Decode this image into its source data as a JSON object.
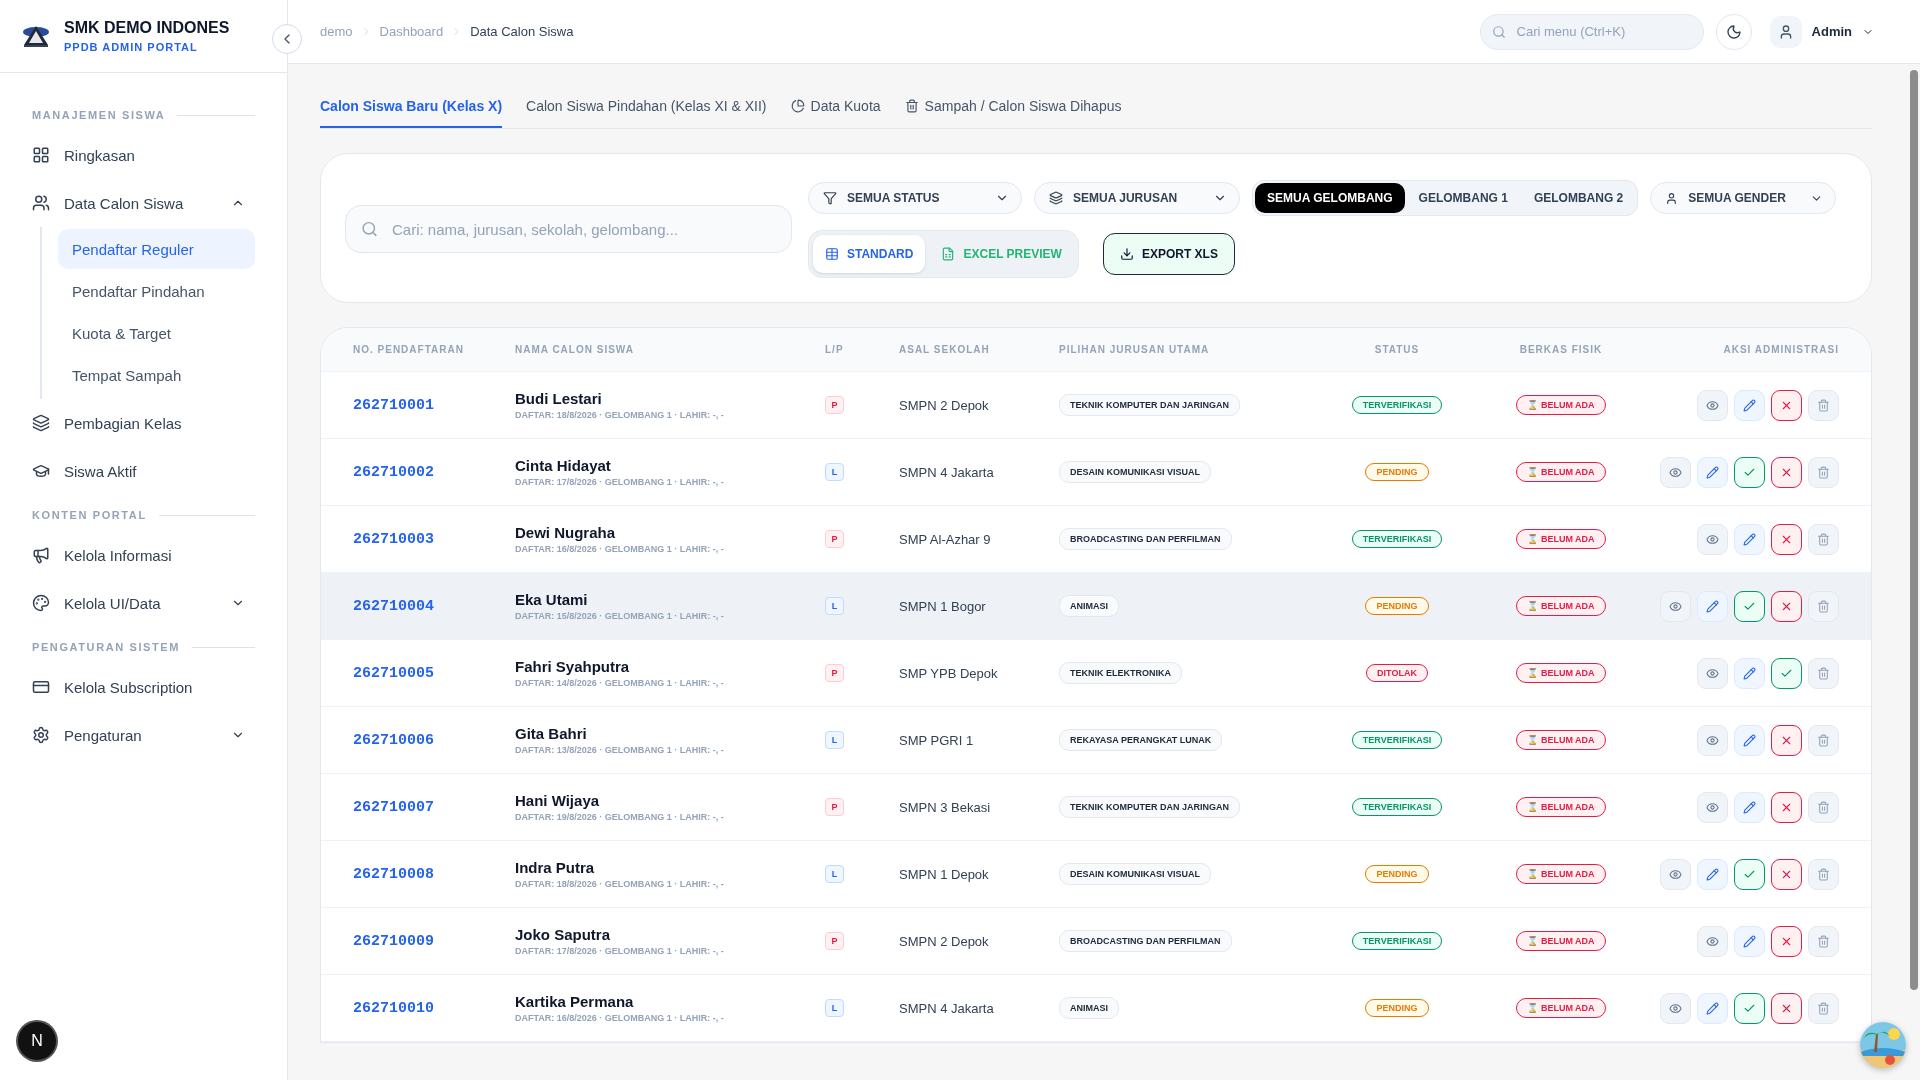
{
  "brand": {
    "name": "SMK DEMO INDONES",
    "subtitle": "PPDB ADMIN PORTAL"
  },
  "breadcrumb": [
    "demo",
    "Dashboard",
    "Data Calon Siswa"
  ],
  "header": {
    "search_placeholder": "Cari menu (Ctrl+K)",
    "user": "Admin"
  },
  "sidebar": {
    "sections": [
      {
        "title": "MANAJEMEN SISWA",
        "items": [
          {
            "label": "Ringkasan",
            "selected": false
          },
          {
            "label": "Data Calon Siswa",
            "selected": false,
            "expanded": true,
            "children": [
              {
                "label": "Pendaftar Reguler",
                "selected": true
              },
              {
                "label": "Pendaftar Pindahan",
                "selected": false
              },
              {
                "label": "Kuota & Target",
                "selected": false
              },
              {
                "label": "Tempat Sampah",
                "selected": false
              }
            ]
          },
          {
            "label": "Pembagian Kelas",
            "selected": false
          },
          {
            "label": "Siswa Aktif",
            "selected": false
          }
        ]
      },
      {
        "title": "KONTEN PORTAL",
        "items": [
          {
            "label": "Kelola Informasi",
            "selected": false
          },
          {
            "label": "Kelola UI/Data",
            "selected": false,
            "expanded": false
          }
        ]
      },
      {
        "title": "PENGATURAN SISTEM",
        "items": [
          {
            "label": "Kelola Subscription",
            "selected": false
          },
          {
            "label": "Pengaturan",
            "selected": false,
            "expanded": false
          }
        ]
      }
    ]
  },
  "tabs": [
    {
      "label": "Calon Siswa Baru (Kelas X)",
      "selected": true
    },
    {
      "label": "Calon Siswa Pindahan (Kelas XI & XII)",
      "selected": false
    },
    {
      "label": "Data Kuota",
      "selected": false
    },
    {
      "label": "Sampah / Calon Siswa Dihapus",
      "selected": false
    }
  ],
  "filters": {
    "search_placeholder": "Cari: nama, jurusan, sekolah, gelombang...",
    "status": "SEMUA STATUS",
    "jurusan": "SEMUA JURUSAN",
    "gelombang": [
      {
        "label": "SEMUA GELOMBANG",
        "selected": true
      },
      {
        "label": "GELOMBANG 1",
        "selected": false
      },
      {
        "label": "GELOMBANG 2",
        "selected": false
      }
    ],
    "gender": "SEMUA GENDER",
    "views": [
      {
        "label": "STANDARD",
        "kind": "table",
        "selected": true
      },
      {
        "label": "EXCEL PREVIEW",
        "kind": "sheet",
        "selected": false
      }
    ],
    "export": "EXPORT XLS"
  },
  "table": {
    "columns": [
      "NO. PENDAFTARAN",
      "NAMA CALON SISWA",
      "L/P",
      "ASAL SEKOLAH",
      "PILIHAN JURUSAN UTAMA",
      "STATUS",
      "BERKAS FISIK",
      "AKSI ADMINISTRASI"
    ],
    "rows": [
      {
        "no": "262710001",
        "name": "Budi Lestari",
        "meta": "DAFTAR: 18/8/2026 · GELOMBANG 1 · LAHIR: -, -",
        "gender": "P",
        "school": "SMPN 2 Depok",
        "major": "TEKNIK KOMPUTER DAN JARINGAN",
        "status": "TERVERIFIKASI",
        "kind": "verified",
        "berkas": "⌛ BELUM ADA",
        "highlighted": false
      },
      {
        "no": "262710002",
        "name": "Cinta Hidayat",
        "meta": "DAFTAR: 17/8/2026 · GELOMBANG 1 · LAHIR: -, -",
        "gender": "L",
        "school": "SMPN 4 Jakarta",
        "major": "DESAIN KOMUNIKASI VISUAL",
        "status": "PENDING",
        "kind": "pending",
        "berkas": "⌛ BELUM ADA",
        "highlighted": false
      },
      {
        "no": "262710003",
        "name": "Dewi Nugraha",
        "meta": "DAFTAR: 16/8/2026 · GELOMBANG 1 · LAHIR: -, -",
        "gender": "P",
        "school": "SMP Al-Azhar 9",
        "major": "BROADCASTING DAN PERFILMAN",
        "status": "TERVERIFIKASI",
        "kind": "verified",
        "berkas": "⌛ BELUM ADA",
        "highlighted": false
      },
      {
        "no": "262710004",
        "name": "Eka Utami",
        "meta": "DAFTAR: 15/8/2026 · GELOMBANG 1 · LAHIR: -, -",
        "gender": "L",
        "school": "SMPN 1 Bogor",
        "major": "ANIMASI",
        "status": "PENDING",
        "kind": "pending",
        "berkas": "⌛ BELUM ADA",
        "highlighted": true
      },
      {
        "no": "262710005",
        "name": "Fahri Syahputra",
        "meta": "DAFTAR: 14/8/2026 · GELOMBANG 1 · LAHIR: -, -",
        "gender": "P",
        "school": "SMP YPB Depok",
        "major": "TEKNIK ELEKTRONIKA",
        "status": "DITOLAK",
        "kind": "rejected",
        "berkas": "⌛ BELUM ADA",
        "highlighted": false
      },
      {
        "no": "262710006",
        "name": "Gita Bahri",
        "meta": "DAFTAR: 13/8/2026 · GELOMBANG 1 · LAHIR: -, -",
        "gender": "L",
        "school": "SMP PGRI 1",
        "major": "REKAYASA PERANGKAT LUNAK",
        "status": "TERVERIFIKASI",
        "kind": "verified",
        "berkas": "⌛ BELUM ADA",
        "highlighted": false
      },
      {
        "no": "262710007",
        "name": "Hani Wijaya",
        "meta": "DAFTAR: 19/8/2026 · GELOMBANG 1 · LAHIR: -, -",
        "gender": "P",
        "school": "SMPN 3 Bekasi",
        "major": "TEKNIK KOMPUTER DAN JARINGAN",
        "status": "TERVERIFIKASI",
        "kind": "verified",
        "berkas": "⌛ BELUM ADA",
        "highlighted": false
      },
      {
        "no": "262710008",
        "name": "Indra Putra",
        "meta": "DAFTAR: 18/8/2026 · GELOMBANG 1 · LAHIR: -, -",
        "gender": "L",
        "school": "SMPN 1 Depok",
        "major": "DESAIN KOMUNIKASI VISUAL",
        "status": "PENDING",
        "kind": "pending",
        "berkas": "⌛ BELUM ADA",
        "highlighted": false
      },
      {
        "no": "262710009",
        "name": "Joko Saputra",
        "meta": "DAFTAR: 17/8/2026 · GELOMBANG 1 · LAHIR: -, -",
        "gender": "P",
        "school": "SMPN 2 Depok",
        "major": "BROADCASTING DAN PERFILMAN",
        "status": "TERVERIFIKASI",
        "kind": "verified",
        "berkas": "⌛ BELUM ADA",
        "highlighted": false
      },
      {
        "no": "262710010",
        "name": "Kartika Permana",
        "meta": "DAFTAR: 16/8/2026 · GELOMBANG 1 · LAHIR: -, -",
        "gender": "L",
        "school": "SMPN 4 Jakarta",
        "major": "ANIMASI",
        "status": "PENDING",
        "kind": "pending",
        "berkas": "⌛ BELUM ADA",
        "highlighted": false
      }
    ]
  },
  "dev_badge": "N"
}
